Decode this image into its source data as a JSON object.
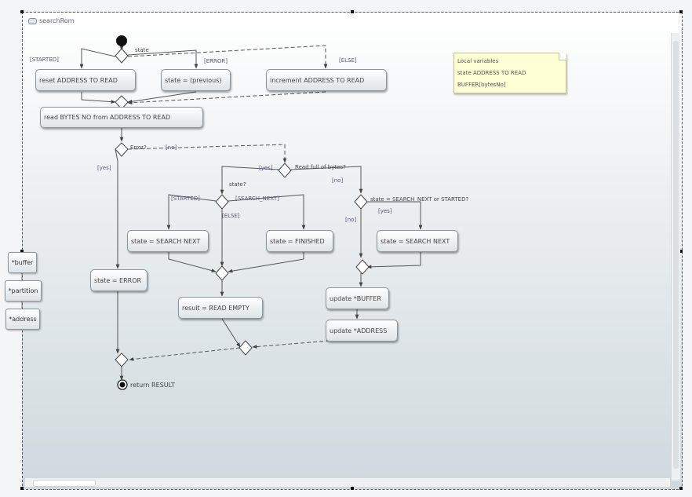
{
  "diagram": {
    "tab_label": "searchRom",
    "start_decision_label": "state",
    "guards": {
      "started": "[STARTED]",
      "error": "[ERROR]",
      "else_top": "[ELSE]",
      "yes_error": "[yes]",
      "no_error": "[no]",
      "yes_read": "[yes]",
      "no_read": "[no]",
      "started2": "[STARTED]",
      "search_next": "[SEARCH_NEXT]",
      "else2": "[ELSE]",
      "yes_state": "[yes]",
      "no_state": "[no]"
    },
    "decisions": {
      "error_q": "Error?",
      "read_full": "Read full of bytes?",
      "state_q": "state?",
      "state_cond": "state = SEARCH_NEXT or STARTED?"
    },
    "actions": {
      "reset": "reset ADDRESS TO READ",
      "state_prev": "state = (previous)",
      "increment": "increment ADDRESS TO READ",
      "read_bytes": "read BYTES NO from ADDRESS TO READ",
      "state_search_next1": "state = SEARCH NEXT",
      "state_finished": "state = FINISHED",
      "state_search_next2": "state = SEARCH NEXT",
      "state_error": "state = ERROR",
      "result_empty": "result = READ EMPTY",
      "update_buffer": "update *BUFFER",
      "update_address": "update *ADDRESS"
    },
    "final_label": "return RESULT",
    "pins": {
      "buffer": "*buffer",
      "partition": "*partition",
      "address": "*address"
    },
    "note": {
      "title": "Local variables",
      "line1": "state ADDRESS TO READ",
      "line2": "BUFFER[bytesNo]"
    }
  }
}
